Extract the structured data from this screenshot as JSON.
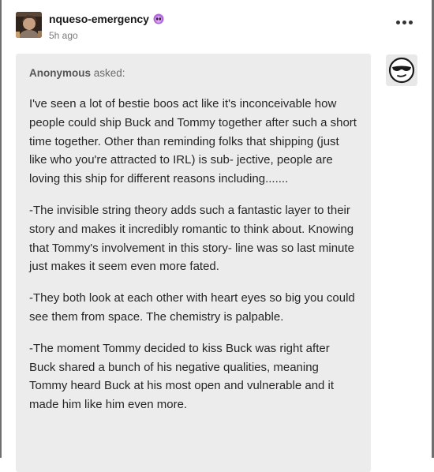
{
  "post": {
    "username": "nqueso-emergency",
    "timestamp": "5h ago",
    "badge_icon": "purple-alien-badge",
    "more_icon": "more-horizontal-icon"
  },
  "ask": {
    "asker_name": "Anonymous",
    "asked_label": " asked:",
    "paragraphs": [
      "I've seen a lot of bestie boos act like it's inconceivable how people could ship Buck and Tommy together after such a short time together. Other than reminding folks that shipping (just like who you're attracted to IRL) is sub- jective, people are loving this ship for different reasons including.......",
      "-The invisible string theory adds such a fantastic layer to their story and makes it incredibly romantic to think about. Knowing that Tommy's involvement in this story- line was so last minute just makes it seem even more fated.",
      "-They both look at each other with heart eyes so big you could see them from space. The chemistry is palpable.",
      "-The moment Tommy decided to kiss Buck was right after Buck shared a bunch of his negative qualities, meaning Tommy heard Buck at his most open and vulnerable and it made him like him even more."
    ]
  },
  "colors": {
    "ask_background": "#ececec",
    "badge": "#b26ad9",
    "frame": "#6f6f6f"
  }
}
